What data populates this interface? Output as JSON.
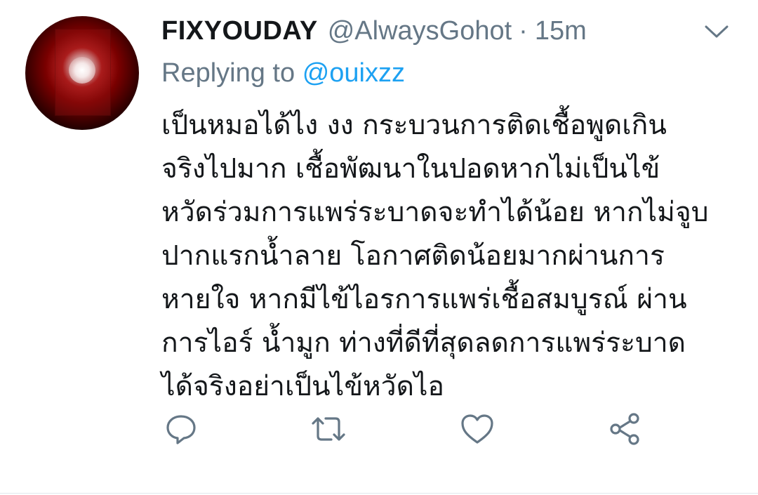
{
  "tweet": {
    "display_name": "FIXYOUDAY",
    "handle": "@AlwaysGohot",
    "separator": "·",
    "time": "15m",
    "replying_prefix": "Replying to",
    "replying_handle": "@ouixzz",
    "text_lines": [
      "เป็นหมอได้ไง งง  กระบวนการติดเชื้อพูดเกิน",
      "จริงไปมาก  เชื้อพัฒนาในปอดหากไม่เป็นไข้",
      "หวัดร่วมการแพร่ระบาดจะทำได้น้อย หากไม่จูบ",
      "ปากแรกน้ำลาย โอกาศติดน้อยมากผ่านการ",
      "หายใจ หากมีไข้ไอรการแพร่เชื้อสมบูรณ์  ผ่าน",
      "การไอร์ น้ำมูก  ท่างที่ดีที่สุดลดการแพร่ระบาด",
      "ได้จริงอย่าเป็นไข้หวัดไอ"
    ]
  },
  "icons": {
    "menu": "chevron-down-icon",
    "reply": "reply-icon",
    "retweet": "retweet-icon",
    "like": "like-icon",
    "share": "share-icon"
  },
  "colors": {
    "primary_text": "#14171a",
    "secondary_text": "#657786",
    "link": "#1da1f2",
    "icon": "#657786"
  }
}
